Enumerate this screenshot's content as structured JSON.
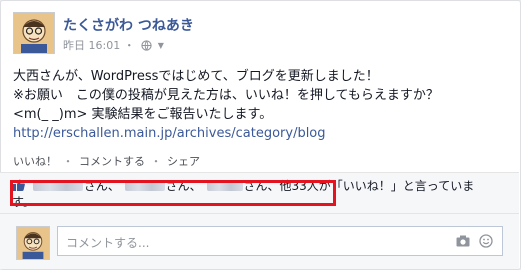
{
  "post": {
    "author": "たくさがわ つねあき",
    "timestamp": "昨日 16:01",
    "separator": "・",
    "lines": [
      "大西さんが、WordPressではじめて、ブログを更新しました！",
      "※お願い　この僕の投稿が見えた方は、いいね！を押してもらえますか？",
      "<m(_ _)m> 実験結果をご報告いたします。"
    ],
    "link": "http://erschallen.main.jp/archives/category/blog"
  },
  "actions": {
    "like": "いいね！",
    "comment": "コメントする",
    "share": "シェア",
    "sep": "・"
  },
  "likes": {
    "san1": "さん、",
    "san2": "さん、",
    "san3": "さん、",
    "rest": "他33人が「いいね！」と言ってい",
    "wrap_line1_end": "ま",
    "wrap_line2": "す。"
  },
  "comment": {
    "placeholder": "コメントする..."
  },
  "colors": {
    "link": "#3b5998",
    "highlight": "#e3131f",
    "muted": "#90949c"
  },
  "icons": [
    "globe-icon",
    "thumbs-up-icon",
    "camera-icon",
    "smiley-icon"
  ]
}
